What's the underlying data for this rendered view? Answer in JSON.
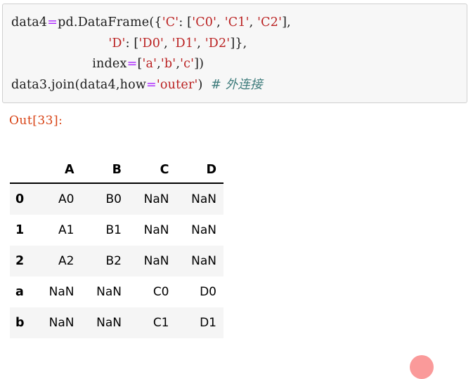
{
  "notebook": {
    "input_cell": {
      "lines": [
        [
          {
            "t": "data4",
            "k": "plain"
          },
          {
            "t": "=",
            "k": "op"
          },
          {
            "t": "pd.DataFrame({",
            "k": "plain"
          },
          {
            "t": "'C'",
            "k": "str"
          },
          {
            "t": ": [",
            "k": "plain"
          },
          {
            "t": "'C0'",
            "k": "str"
          },
          {
            "t": ", ",
            "k": "plain"
          },
          {
            "t": "'C1'",
            "k": "str"
          },
          {
            "t": ", ",
            "k": "plain"
          },
          {
            "t": "'C2'",
            "k": "str"
          },
          {
            "t": "],",
            "k": "plain"
          }
        ],
        [
          {
            "t": "                        ",
            "k": "plain"
          },
          {
            "t": "'D'",
            "k": "str"
          },
          {
            "t": ": [",
            "k": "plain"
          },
          {
            "t": "'D0'",
            "k": "str"
          },
          {
            "t": ", ",
            "k": "plain"
          },
          {
            "t": "'D1'",
            "k": "str"
          },
          {
            "t": ", ",
            "k": "plain"
          },
          {
            "t": "'D2'",
            "k": "str"
          },
          {
            "t": "]},",
            "k": "plain"
          }
        ],
        [
          {
            "t": "                    index",
            "k": "plain"
          },
          {
            "t": "=",
            "k": "op"
          },
          {
            "t": "[",
            "k": "plain"
          },
          {
            "t": "'a'",
            "k": "str"
          },
          {
            "t": ",",
            "k": "plain"
          },
          {
            "t": "'b'",
            "k": "str"
          },
          {
            "t": ",",
            "k": "plain"
          },
          {
            "t": "'c'",
            "k": "str"
          },
          {
            "t": "])",
            "k": "plain"
          }
        ],
        [
          {
            "t": "data3.join(data4,how",
            "k": "plain"
          },
          {
            "t": "=",
            "k": "op"
          },
          {
            "t": "'outer'",
            "k": "str"
          },
          {
            "t": ")  ",
            "k": "plain"
          },
          {
            "t": "# 外连接",
            "k": "com"
          }
        ]
      ],
      "plain_text": "data4=pd.DataFrame({'C' : ['C0', 'C1', 'C2'],\n                        'D' : ['D0', 'D1', 'D2']},\n                    index=['a','b','c'])\ndata3.join(data4,how='outer')  # 外连接"
    },
    "output_prompt": "Out[33]:",
    "colors": {
      "cell_background": "#f7f7f7",
      "cell_border": "#cfcfcf",
      "string_token": "#ba2121",
      "operator_token": "#aa22ff",
      "comment_token": "#3d7b7b",
      "prompt": "#d84315",
      "table_stripe": "#f5f5f5",
      "arc": "#fa9a9a"
    }
  },
  "dataframe": {
    "corner_label": "",
    "columns": [
      "A",
      "B",
      "C",
      "D"
    ],
    "index": [
      "0",
      "1",
      "2",
      "a",
      "b"
    ],
    "rows": [
      {
        "index": "0",
        "cells": [
          "A0",
          "B0",
          "NaN",
          "NaN"
        ],
        "striped": true
      },
      {
        "index": "1",
        "cells": [
          "A1",
          "B1",
          "NaN",
          "NaN"
        ],
        "striped": false
      },
      {
        "index": "2",
        "cells": [
          "A2",
          "B2",
          "NaN",
          "NaN"
        ],
        "striped": true
      },
      {
        "index": "a",
        "cells": [
          "NaN",
          "NaN",
          "C0",
          "D0"
        ],
        "striped": false
      },
      {
        "index": "b",
        "cells": [
          "NaN",
          "NaN",
          "C1",
          "D1"
        ],
        "striped": true
      }
    ]
  }
}
